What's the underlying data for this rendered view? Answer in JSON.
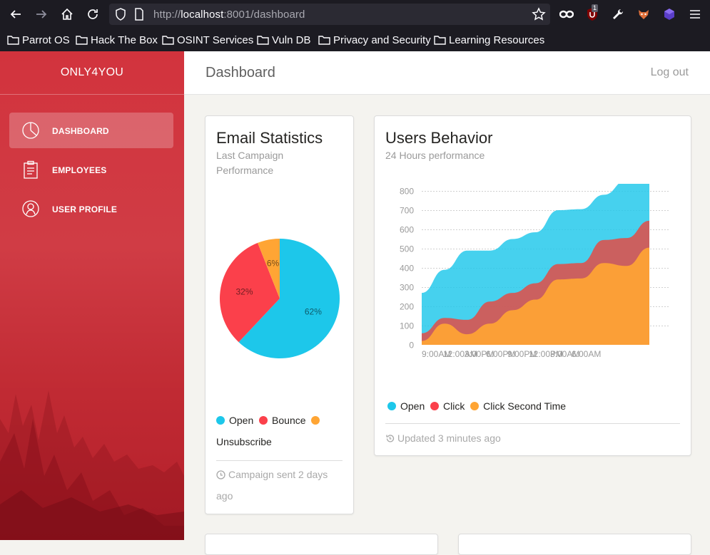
{
  "browser": {
    "url_scheme": "http://",
    "url_host": "localhost",
    "url_rest": ":8001/dashboard",
    "badge_count": "1",
    "bookmarks": [
      "Parrot OS",
      "Hack The Box",
      "OSINT Services",
      "Vuln DB",
      "Privacy and Security",
      "Learning Resources"
    ]
  },
  "sidebar": {
    "brand": "ONLY4YOU",
    "items": [
      {
        "label": "DASHBOARD",
        "icon": "pie-chart-icon",
        "active": true
      },
      {
        "label": "EMPLOYEES",
        "icon": "clipboard-icon",
        "active": false
      },
      {
        "label": "USER PROFILE",
        "icon": "user-icon",
        "active": false
      }
    ]
  },
  "topbar": {
    "title": "Dashboard",
    "logout": "Log out"
  },
  "email_card": {
    "title": "Email Statistics",
    "subtitle": "Last Campaign Performance",
    "legend": [
      "Open",
      "Bounce",
      "Unsubscribe"
    ],
    "footer": "Campaign sent 2 days ago"
  },
  "users_card": {
    "title": "Users Behavior",
    "subtitle": "24 Hours performance",
    "legend": [
      "Open",
      "Click",
      "Click Second Time"
    ],
    "footer": "Updated 3 minutes ago"
  },
  "colors": {
    "open": "#1dc7ea",
    "bounce": "#fb404b",
    "unsubscribe": "#ffa534",
    "click": "#d9534f"
  },
  "chart_data": [
    {
      "type": "pie",
      "labels": [
        "Open",
        "Bounce",
        "Unsubscribe"
      ],
      "values": [
        62,
        32,
        6
      ],
      "value_labels": [
        "62%",
        "32%",
        "6%"
      ]
    },
    {
      "type": "area",
      "x": [
        "9:00AM",
        "12:00AM",
        "3:00PM",
        "6:00PM",
        "9:00PM",
        "12:00PM",
        "3:00AM",
        "6:00AM"
      ],
      "ylim": [
        0,
        800
      ],
      "yticks": [
        0,
        100,
        200,
        300,
        400,
        500,
        600,
        700,
        800
      ],
      "grid": true,
      "legend": "bottom",
      "series": [
        {
          "name": "Open",
          "values": [
            270,
            390,
            490,
            490,
            550,
            585,
            700,
            705,
            780,
            855,
            860
          ]
        },
        {
          "name": "Click",
          "values": [
            60,
            140,
            130,
            225,
            270,
            320,
            420,
            425,
            545,
            555,
            645
          ]
        },
        {
          "name": "Click Second Time",
          "values": [
            20,
            110,
            55,
            110,
            180,
            235,
            340,
            345,
            425,
            410,
            505
          ]
        }
      ]
    }
  ]
}
